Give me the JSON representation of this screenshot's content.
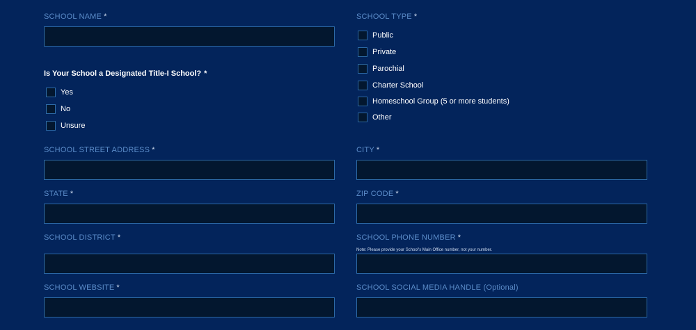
{
  "required_mark": "*",
  "school_name": {
    "label": "SCHOOL NAME"
  },
  "title1": {
    "question": "Is Your School a Designated Title-I School?",
    "options": [
      "Yes",
      "No",
      "Unsure"
    ]
  },
  "school_type": {
    "label": "SCHOOL TYPE",
    "options": [
      "Public",
      "Private",
      "Parochial",
      "Charter School",
      "Homeschool Group (5 or more students)",
      "Other"
    ]
  },
  "street_address": {
    "label": "SCHOOL STREET ADDRESS"
  },
  "city": {
    "label": "CITY"
  },
  "state": {
    "label": "STATE"
  },
  "zip": {
    "label": "ZIP CODE"
  },
  "district": {
    "label": "SCHOOL DISTRICT"
  },
  "phone": {
    "label": "SCHOOL PHONE NUMBER",
    "note": "Note: Please provide your School's Main Office number, not your number."
  },
  "website": {
    "label": "SCHOOL WEBSITE"
  },
  "social": {
    "label": "SCHOOL SOCIAL MEDIA HANDLE (Optional)"
  }
}
